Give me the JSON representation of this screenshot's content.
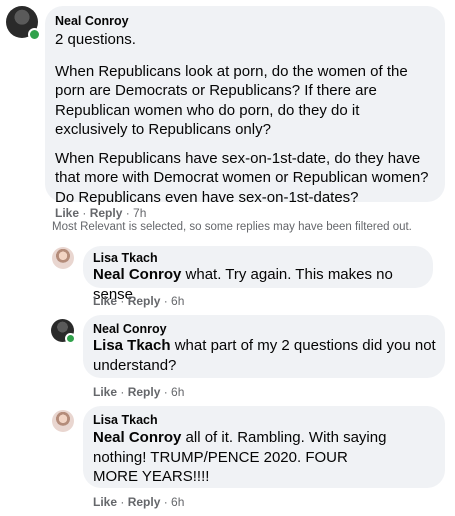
{
  "comment": {
    "author": "Neal Conroy",
    "paragraphs": [
      "2 questions.",
      "When Republicans look at porn, do the women of the porn are Democrats or Republicans? If there are Republican women who do porn, do they do it exclusively to Republicans only?",
      "When Republicans have sex-on-1st-date, do they have that more with Democrat women or Republican women? Do Republicans even have sex-on-1st-dates?"
    ],
    "like": "Like",
    "reply": "Reply",
    "time": "7h"
  },
  "filter_note": "Most Relevant is selected, so some replies may have been filtered out.",
  "replies": [
    {
      "author": "Lisa Tkach",
      "mention": "Neal Conroy",
      "text": " what. Try again. This makes no sense",
      "like": "Like",
      "reply": "Reply",
      "time": "6h"
    },
    {
      "author": "Neal Conroy",
      "mention": "Lisa Tkach",
      "text": " what part of my 2 questions did you not understand?",
      "like": "Like",
      "reply": "Reply",
      "time": "6h"
    },
    {
      "author": "Lisa Tkach",
      "mention": "Neal Conroy",
      "text": " all of it. Rambling. With saying nothing! TRUMP/PENCE 2020. FOUR MORE YEARS!!!!",
      "like": "Like",
      "reply": "Reply",
      "time": "6h"
    }
  ],
  "colors": {
    "bubble": "#f0f2f5",
    "meta_text": "#65676b",
    "online": "#31a24c"
  }
}
